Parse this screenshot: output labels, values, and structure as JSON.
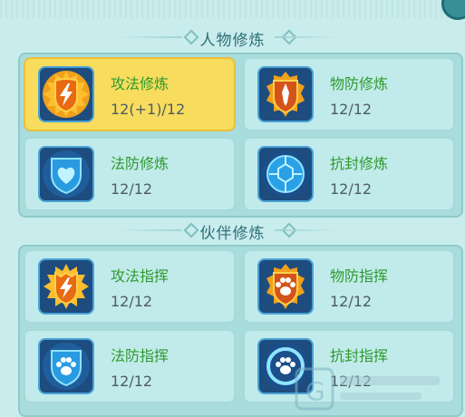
{
  "sections": [
    {
      "title": "人物修炼",
      "items": [
        {
          "label": "攻法修炼",
          "value": "12(+1)/12",
          "icon": "lightning-shield-icon",
          "selected": true
        },
        {
          "label": "物防修炼",
          "value": "12/12",
          "icon": "sword-shield-icon",
          "selected": false
        },
        {
          "label": "法防修炼",
          "value": "12/12",
          "icon": "heart-shield-icon",
          "selected": false
        },
        {
          "label": "抗封修炼",
          "value": "12/12",
          "icon": "turtle-shell-icon",
          "selected": false
        }
      ]
    },
    {
      "title": "伙伴修炼",
      "items": [
        {
          "label": "攻法指挥",
          "value": "12/12",
          "icon": "lightning-shield-icon",
          "selected": false
        },
        {
          "label": "物防指挥",
          "value": "12/12",
          "icon": "paw-shield-icon",
          "selected": false
        },
        {
          "label": "法防指挥",
          "value": "12/12",
          "icon": "paw-blue-shield-icon",
          "selected": false
        },
        {
          "label": "抗封指挥",
          "value": "12/12",
          "icon": "paw-ring-icon",
          "selected": false
        }
      ]
    }
  ],
  "colors": {
    "label": "#2f9a2f",
    "value": "#4d5d63",
    "selected_bg": "#f7dc5d",
    "card_bg": "#c1ebea"
  }
}
